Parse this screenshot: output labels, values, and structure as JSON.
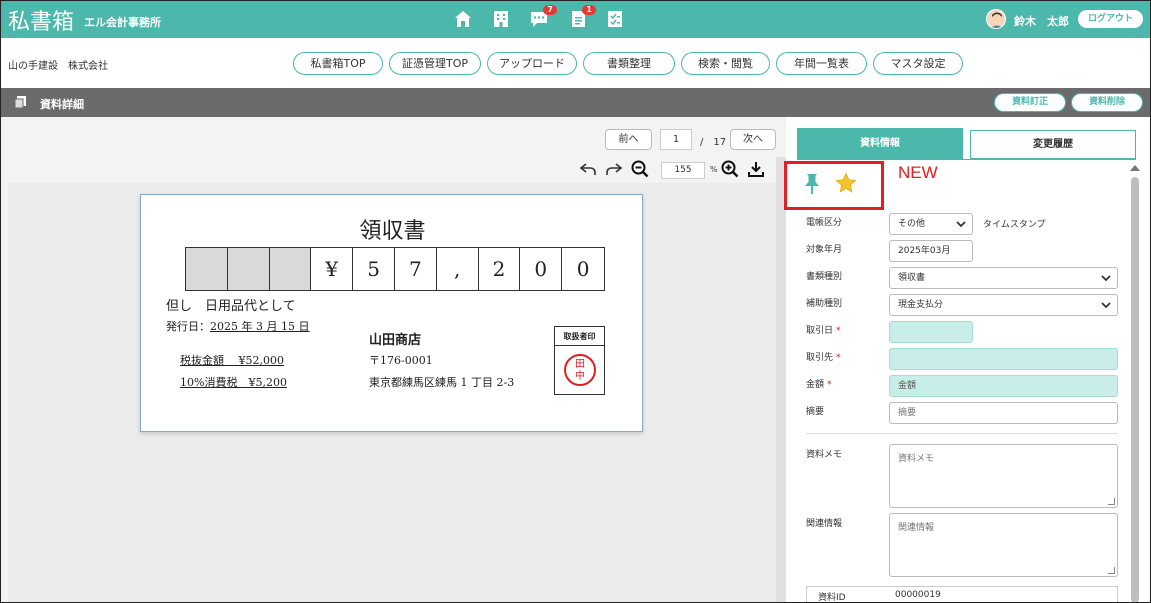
{
  "header": {
    "brand": "私書箱",
    "firm": "エル会計事務所",
    "icons": [
      {
        "name": "home-icon",
        "badge": ""
      },
      {
        "name": "building-icon",
        "badge": ""
      },
      {
        "name": "chat-icon",
        "badge": "7"
      },
      {
        "name": "document-icon",
        "badge": "1"
      },
      {
        "name": "checklist-icon",
        "badge": ""
      }
    ],
    "user_name": "鈴木　太郎",
    "logout_label": "ログアウト",
    "colors": {
      "accent": "#4cb8ac",
      "alert": "#e53935"
    }
  },
  "company": "山の手建設　株式会社",
  "nav": [
    "私書箱TOP",
    "証憑管理TOP",
    "アップロード",
    "書類整理",
    "検索・閲覧",
    "年間一覧表",
    "マスタ設定"
  ],
  "titlebar": {
    "title": "資料詳細",
    "edit_label": "資料訂正",
    "delete_label": "資料削除"
  },
  "viewer": {
    "prev_label": "前へ",
    "next_label": "次へ",
    "page": "1",
    "page_total": "/　17",
    "zoom": "155",
    "zoom_unit": "%"
  },
  "receipt": {
    "title": "領収書",
    "amount_digits": [
      "",
      "",
      "",
      "¥",
      "5",
      "7",
      ",",
      "2",
      "0",
      "0"
    ],
    "memo": "但し　日用品代として",
    "issue_label": "発行日：",
    "issue_date": "2025 年 3 月 15 日",
    "store": "山田商店",
    "postal": "〒176-0001",
    "address": "東京都練馬区練馬 1 丁目 2-3",
    "tax_excl": "税抜金額　 ¥52,000",
    "tax": "10%消費税　¥5,200",
    "stamp_label": "取扱者印",
    "stamp_line1": "田",
    "stamp_line2": "中"
  },
  "panel": {
    "tab_info": "資料情報",
    "tab_history": "変更履歴",
    "new_label": "NEW",
    "fields": {
      "ledger_label": "電帳区分",
      "ledger_value": "その他",
      "timestamp_label": "タイムスタンプ",
      "period_label": "対象年月",
      "period_value": "2025年03月",
      "doctype_label": "書類種別",
      "doctype_value": "領収書",
      "subtype_label": "補助種別",
      "subtype_value": "現金支払分",
      "txdate_label": "取引日",
      "partner_label": "取引先",
      "amount_label": "金額",
      "amount_placeholder": "金額",
      "summary_label": "摘要",
      "summary_placeholder": "摘要",
      "memo_label": "資料メモ",
      "memo_placeholder": "資料メモ",
      "related_label": "関連情報",
      "related_placeholder": "関連情報",
      "required_mark": "*",
      "id_label": "資料ID",
      "id_value": "00000019"
    }
  }
}
